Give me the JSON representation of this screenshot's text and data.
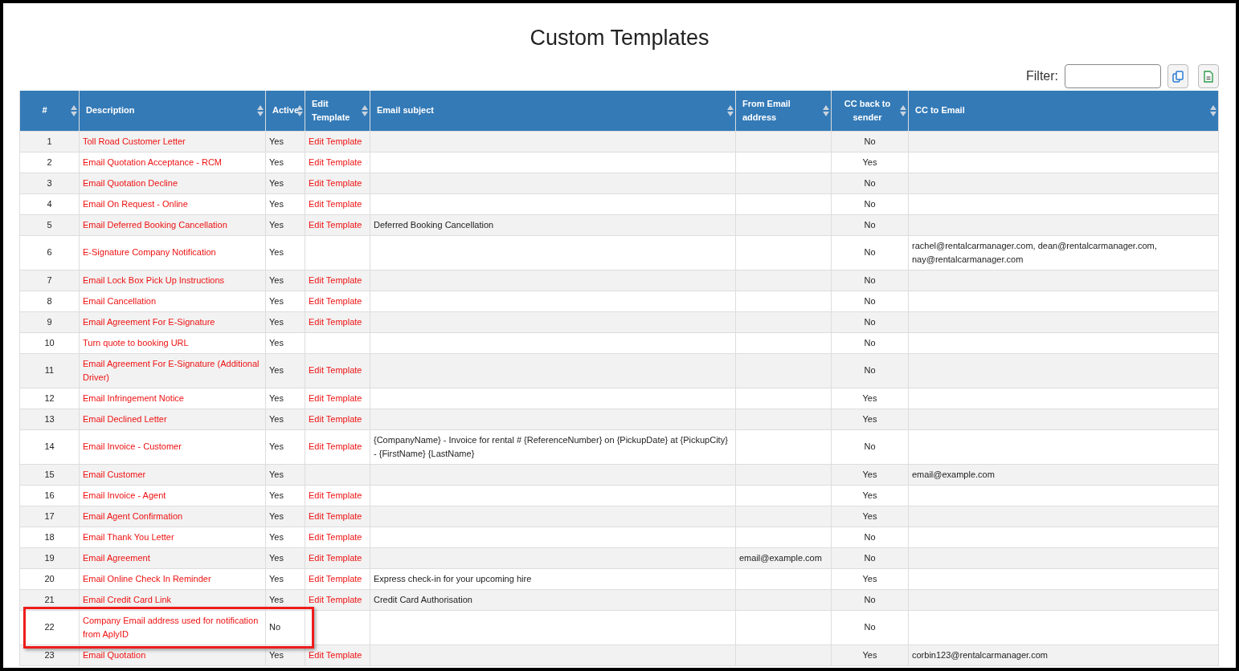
{
  "title": "Custom Templates",
  "filter": {
    "label": "Filter:"
  },
  "toolbar_buttons": [
    {
      "kind": "copy"
    },
    {
      "kind": "export"
    }
  ],
  "table": {
    "columns": [
      "#",
      "Description",
      "Active",
      "Edit Template",
      "Email subject",
      "From Email address",
      "CC back to sender",
      "CC to Email"
    ],
    "rows": [
      {
        "cells": [
          "1",
          "Toll Road Customer Letter",
          "Yes",
          "Edit Template",
          "",
          "",
          "No",
          ""
        ],
        "highlighted": false
      },
      {
        "cells": [
          "2",
          "Email Quotation Acceptance - RCM",
          "Yes",
          "Edit Template",
          "",
          "",
          "Yes",
          ""
        ],
        "highlighted": false
      },
      {
        "cells": [
          "3",
          "Email Quotation Decline",
          "Yes",
          "Edit Template",
          "",
          "",
          "No",
          ""
        ],
        "highlighted": false
      },
      {
        "cells": [
          "4",
          "Email On Request - Online",
          "Yes",
          "Edit Template",
          "",
          "",
          "No",
          ""
        ],
        "highlighted": false
      },
      {
        "cells": [
          "5",
          "Email Deferred Booking Cancellation",
          "Yes",
          "Edit Template",
          "Deferred Booking Cancellation",
          "",
          "No",
          ""
        ],
        "highlighted": false
      },
      {
        "cells": [
          "6",
          "E-Signature Company Notification",
          "Yes",
          "",
          "",
          "",
          "No",
          "rachel@rentalcarmanager.com, dean@rentalcarmanager.com, nay@rentalcarmanager.com"
        ],
        "highlighted": false
      },
      {
        "cells": [
          "7",
          "Email Lock Box Pick Up Instructions",
          "Yes",
          "Edit Template",
          "",
          "",
          "No",
          ""
        ],
        "highlighted": false
      },
      {
        "cells": [
          "8",
          "Email Cancellation",
          "Yes",
          "Edit Template",
          "",
          "",
          "No",
          ""
        ],
        "highlighted": false
      },
      {
        "cells": [
          "9",
          "Email Agreement For E-Signature",
          "Yes",
          "Edit Template",
          "",
          "",
          "No",
          ""
        ],
        "highlighted": false
      },
      {
        "cells": [
          "10",
          "Turn quote to booking URL",
          "Yes",
          "",
          "",
          "",
          "No",
          ""
        ],
        "highlighted": false
      },
      {
        "cells": [
          "11",
          "Email Agreement For E-Signature (Additional Driver)",
          "Yes",
          "Edit Template",
          "",
          "",
          "No",
          ""
        ],
        "highlighted": false
      },
      {
        "cells": [
          "12",
          "Email Infringement Notice",
          "Yes",
          "Edit Template",
          "",
          "",
          "Yes",
          ""
        ],
        "highlighted": false
      },
      {
        "cells": [
          "13",
          "Email Declined Letter",
          "Yes",
          "Edit Template",
          "",
          "",
          "Yes",
          ""
        ],
        "highlighted": false
      },
      {
        "cells": [
          "14",
          "Email Invoice - Customer",
          "Yes",
          "Edit Template",
          "{CompanyName} - Invoice for rental # {ReferenceNumber} on {PickupDate} at {PickupCity} - {FirstName} {LastName}",
          "",
          "No",
          ""
        ],
        "highlighted": false
      },
      {
        "cells": [
          "15",
          "Email Customer",
          "Yes",
          "",
          "",
          "",
          "Yes",
          "email@example.com"
        ],
        "highlighted": false
      },
      {
        "cells": [
          "16",
          "Email Invoice - Agent",
          "Yes",
          "Edit Template",
          "",
          "",
          "Yes",
          ""
        ],
        "highlighted": false
      },
      {
        "cells": [
          "17",
          "Email Agent Confirmation",
          "Yes",
          "Edit Template",
          "",
          "",
          "Yes",
          ""
        ],
        "highlighted": false
      },
      {
        "cells": [
          "18",
          "Email Thank You Letter",
          "Yes",
          "Edit Template",
          "",
          "",
          "No",
          ""
        ],
        "highlighted": false
      },
      {
        "cells": [
          "19",
          "Email Agreement",
          "Yes",
          "Edit Template",
          "",
          "email@example.com",
          "No",
          ""
        ],
        "highlighted": false
      },
      {
        "cells": [
          "20",
          "Email Online Check In Reminder",
          "Yes",
          "Edit Template",
          "Express check-in for your upcoming hire",
          "",
          "Yes",
          ""
        ],
        "highlighted": false
      },
      {
        "cells": [
          "21",
          "Email Credit Card Link",
          "Yes",
          "Edit Template",
          "Credit Card Authorisation",
          "",
          "No",
          ""
        ],
        "highlighted": false
      },
      {
        "cells": [
          "22",
          "Company Email address used for notification from AplyID",
          "No",
          "",
          "",
          "",
          "No",
          ""
        ],
        "highlighted": true
      },
      {
        "cells": [
          "23",
          "Email Quotation",
          "Yes",
          "Edit Template",
          "",
          "",
          "Yes",
          "corbin123@rentalcarmanager.com"
        ],
        "highlighted": false
      }
    ]
  }
}
